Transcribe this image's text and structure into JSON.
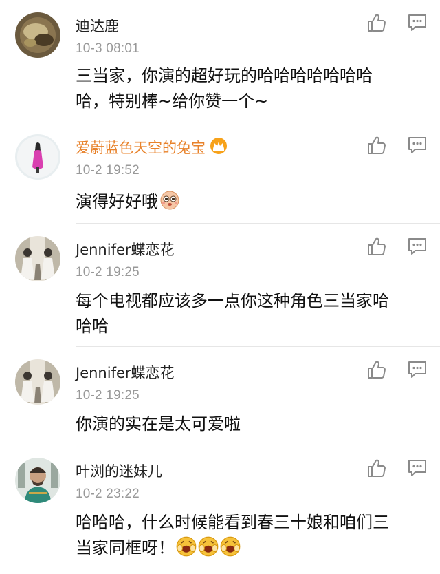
{
  "comments": [
    {
      "user": "迪达鹿",
      "time": "10-3 08:01",
      "text": "三当家，你演的超好玩的哈哈哈哈哈哈哈哈，特别棒~给你赞一个~",
      "line1": "三当家，你演的超好玩的哈哈哈哈哈哈哈",
      "line2": "哈，特别棒~给你赞一个~"
    },
    {
      "user": "爱蔚蓝色天空的兔宝",
      "time": "10-2 19:52",
      "text": "演得好好哦",
      "vip": true
    },
    {
      "user": "Jennifer蝶恋花",
      "time": "10-2 19:25",
      "text": "每个电视都应该多一点你这种角色三当家哈哈哈",
      "line1": "每个电视都应该多一点你这种角色三当家哈",
      "line2": "哈哈"
    },
    {
      "user": "Jennifer蝶恋花",
      "time": "10-2 19:25",
      "text": "你演的实在是太可爱啦"
    },
    {
      "user": "叶浏的迷妹儿",
      "time": "10-2 23:22",
      "text": "哈哈哈，什么时候能看到春三十娘和咱们三当家同框呀！",
      "line1": "哈哈哈，什么时候能看到春三十娘和咱们三",
      "line2": "当家同框呀！"
    }
  ],
  "icons": {
    "like": "thumbs-up-icon",
    "reply": "comment-icon"
  },
  "colors": {
    "name": "#222222",
    "vip_name": "#e8822a",
    "time": "#999999",
    "text": "#111111",
    "icon": "#8a8a8a",
    "divider": "#e6e6e6"
  }
}
